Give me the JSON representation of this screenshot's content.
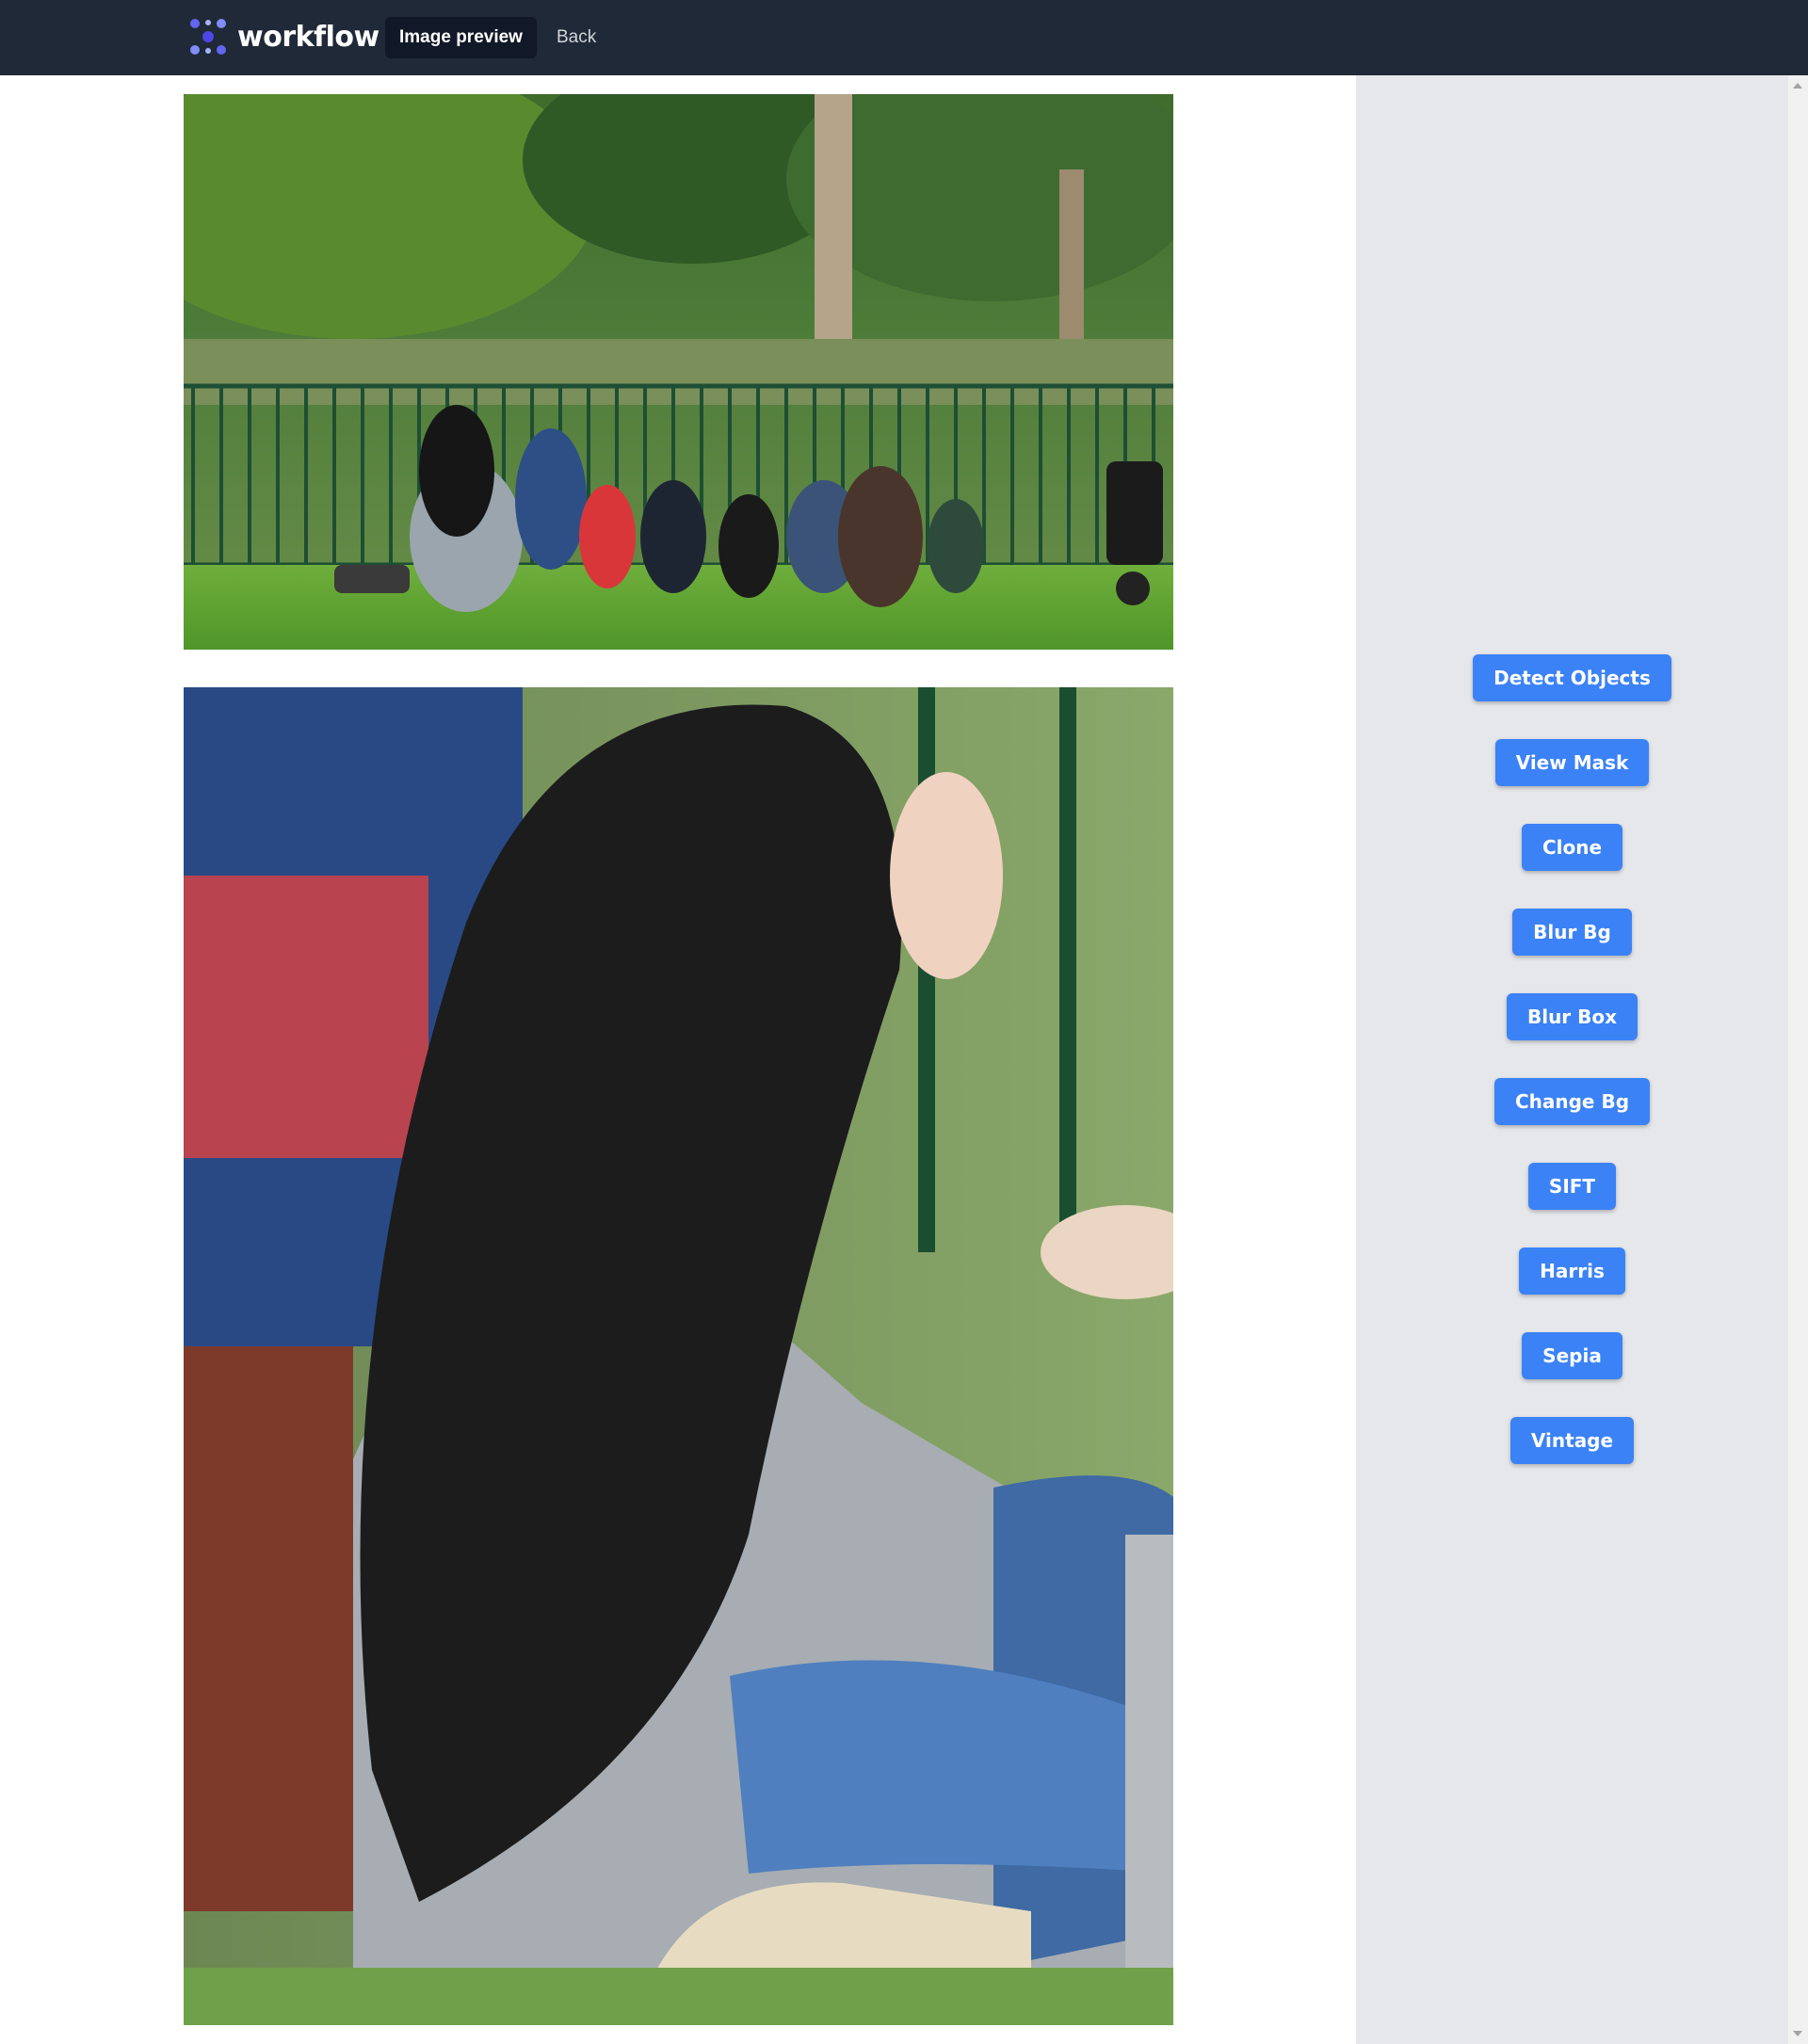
{
  "app": {
    "brand_name": "workflow",
    "logo_icon": "workflow-logo-icon",
    "nav": {
      "active_tab": "Image preview",
      "back": "Back"
    }
  },
  "preview": {
    "images": [
      {
        "kind": "original photo",
        "subject": "group picnic in park"
      },
      {
        "kind": "zoomed crop",
        "subject": "person in black headscarf"
      }
    ]
  },
  "tools": {
    "buttons": [
      "Detect Objects",
      "View Mask",
      "Clone",
      "Blur Bg",
      "Blur Box",
      "Change Bg",
      "SIFT",
      "Harris",
      "Sepia",
      "Vintage"
    ]
  },
  "colors": {
    "topbar": "#1f2937",
    "sidebar": "#e5e7eb",
    "button": "#3b82f6",
    "logo_accent": "#6366f1"
  }
}
